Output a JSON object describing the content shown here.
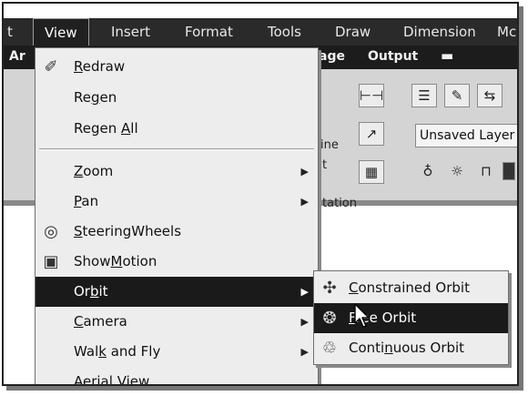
{
  "menubar": {
    "items": [
      "t",
      "View",
      "Insert",
      "Format",
      "Tools",
      "Draw",
      "Dimension",
      "Mc"
    ]
  },
  "ribbon": {
    "tabs": [
      "Ar",
      "age",
      "Output"
    ],
    "layer_combo": "Unsaved Layer",
    "panel_labels": [
      "ine",
      "t",
      "tation"
    ]
  },
  "view_menu": {
    "items": [
      {
        "pre": "",
        "u": "R",
        "post": "edraw"
      },
      {
        "pre": "Re",
        "u": "g",
        "post": "en"
      },
      {
        "pre": "Regen ",
        "u": "A",
        "post": "ll"
      },
      {
        "pre": "",
        "u": "Z",
        "post": "oom"
      },
      {
        "pre": "",
        "u": "P",
        "post": "an"
      },
      {
        "pre": "",
        "u": "S",
        "post": "teeringWheels"
      },
      {
        "pre": "Show",
        "u": "M",
        "post": "otion"
      },
      {
        "pre": "Or",
        "u": "b",
        "post": "it"
      },
      {
        "pre": "",
        "u": "C",
        "post": "amera"
      },
      {
        "pre": "Wal",
        "u": "k",
        "post": " and Fly"
      },
      {
        "pre": "Aerial Vie",
        "u": "w",
        "post": ""
      }
    ]
  },
  "orbit_menu": {
    "items": [
      {
        "pre": "",
        "u": "C",
        "post": "onstrained Orbit"
      },
      {
        "pre": "",
        "u": "F",
        "post": "ree Orbit"
      },
      {
        "pre": "Conti",
        "u": "n",
        "post": "uous Orbit"
      }
    ]
  },
  "icons": {
    "redraw": "redraw-brush-icon",
    "steeringwheels": "steering-wheels-icon",
    "showmotion": "show-motion-icon",
    "constrained": "constrained-orbit-icon",
    "free": "free-orbit-icon",
    "continuous": "continuous-orbit-icon"
  },
  "colors": {
    "highlight": "#1a1a1a",
    "menu_bg": "#ededed",
    "menubar": "#2a2a2a"
  }
}
